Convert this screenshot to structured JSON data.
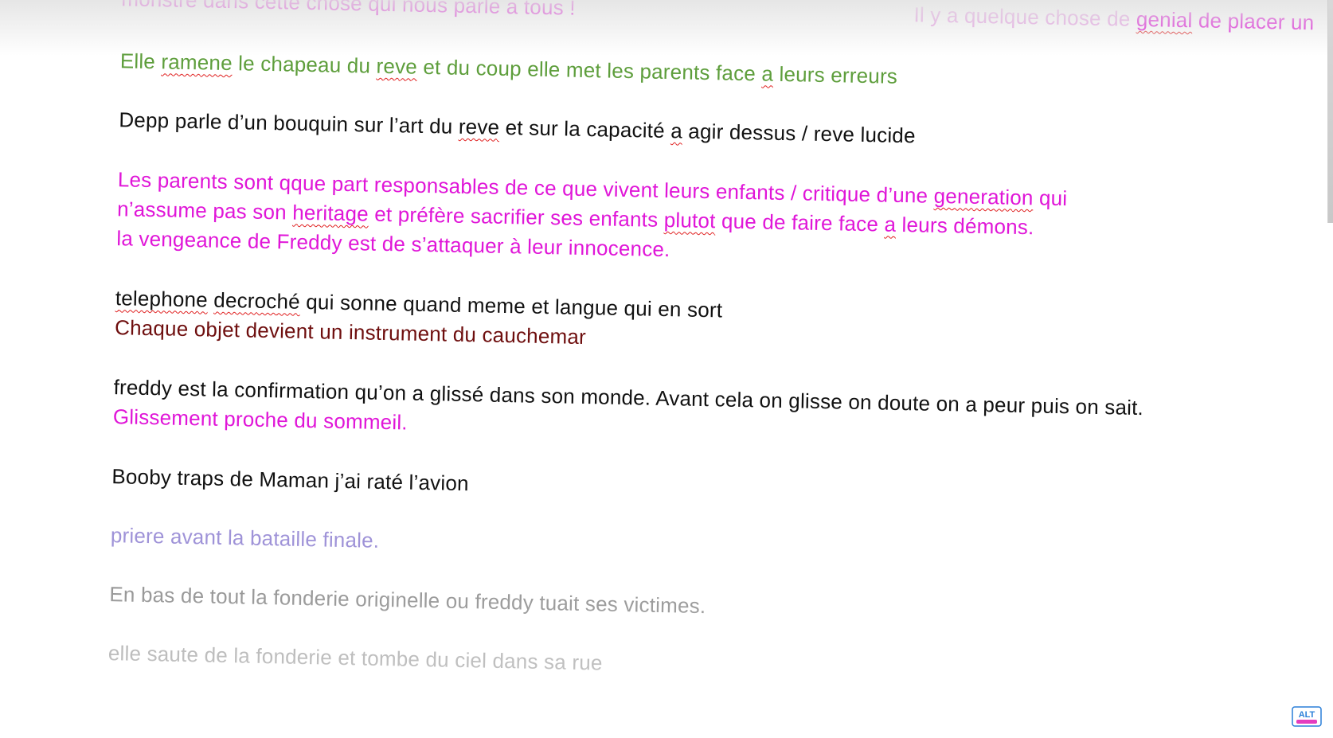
{
  "document": {
    "p1": {
      "t1": "monstre dans cette chose qui nous parle a tous !",
      "t2": "Il y a quelque chose de",
      "t3": "genial",
      "t4": "de placer un"
    },
    "p2": {
      "t1": "Elle",
      "t2": "ramene",
      "t3": "le chapeau du",
      "t4": "reve",
      "t5": "et du coup elle met les parents face",
      "t6": "a",
      "t7": "leurs erreurs"
    },
    "p3": {
      "t1": "Depp parle d’un bouquin sur l’art du",
      "t2": "reve",
      "t3": "et sur la capacité",
      "t4": "a",
      "t5": "agir dessus / reve lucide"
    },
    "p4": {
      "t1": "Les parents sont qque part responsables de ce que vivent leurs enfants / critique d’une",
      "t2": "generation",
      "t3": "qui n’assume pas son",
      "t4": "heritage",
      "t5": "et préfère sacrifier ses enfants",
      "t6": "plutot",
      "t7": "que de faire face",
      "t8": "a",
      "t9": "leurs démons.",
      "t10": "la vengeance de Freddy est de s’attaquer à leur innocence."
    },
    "p5": {
      "t1": "telephone",
      "t2": "decroché",
      "t3": "qui sonne quand meme et langue qui en sort",
      "t4": "Chaque objet devient un instrument du cauchemar"
    },
    "p6": {
      "t1": "freddy est la confirmation qu’on a glissé dans son monde. Avant cela on glisse on doute on a peur puis on sait.",
      "t2": "Glissement proche du sommeil."
    },
    "p7": {
      "t1": "Booby traps de Maman j’ai raté l’avion"
    },
    "p8": {
      "t1": "priere avant la bataille finale."
    },
    "p9": {
      "t1": "En bas de tout la fonderie originelle ou freddy tuait ses victimes."
    },
    "p10": {
      "t1": "elle saute de la fonderie et tombe du ciel dans sa rue"
    }
  },
  "logo": {
    "text": "ALT"
  },
  "colors": {
    "magenta": "#e016d8",
    "green": "#5e9e3c",
    "black": "#111111",
    "darkred": "#6e0e0e",
    "lavender": "#9f93d8",
    "grey": "#8e8e8e",
    "spellcheck": "#e02020"
  }
}
